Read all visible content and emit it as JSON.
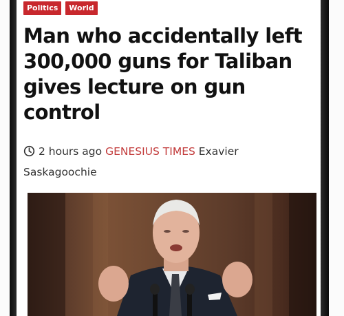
{
  "tags": [
    {
      "label": "Politics",
      "color": "#c8282d"
    },
    {
      "label": "World",
      "color": "#c8282d"
    }
  ],
  "headline": "Man who accidentally left 300,000 guns for Taliban gives lecture on gun control",
  "meta": {
    "time_icon": "clock-icon",
    "time": "2 hours ago",
    "source": "GENESIUS TIMES",
    "author": "Exavier Saskagoochie",
    "source_color": "#c23a3a"
  },
  "photo": {
    "description_icon": "speaker-photo"
  }
}
